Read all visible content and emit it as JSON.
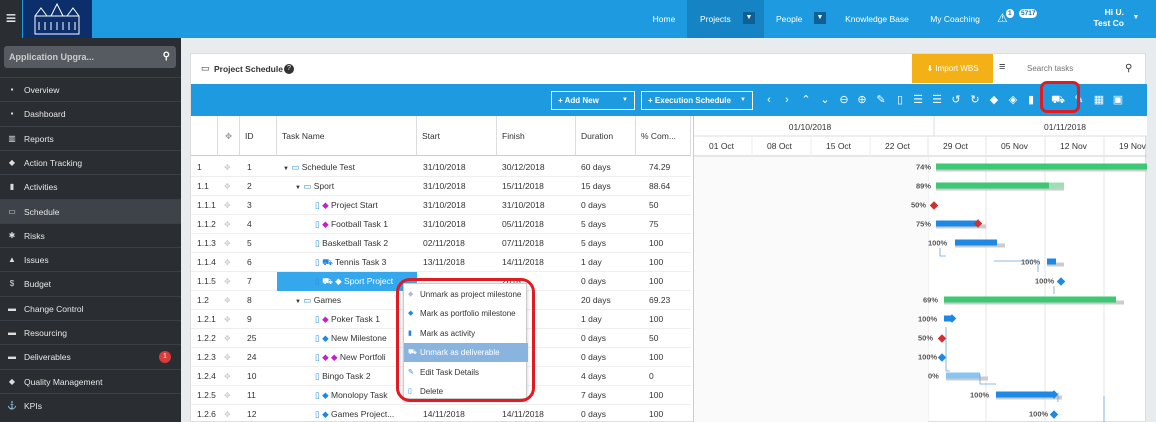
{
  "topbar": {
    "menu_icon": "hamburger-icon",
    "nav": [
      {
        "label": "Home"
      },
      {
        "label": "Projects"
      },
      {
        "label": "People"
      },
      {
        "label": "Knowledge Base"
      },
      {
        "label": "My Coaching"
      }
    ],
    "notification_count": "1",
    "message_count": "5717",
    "user_line1": "Hi U.",
    "user_line2": "Test Co"
  },
  "sidebar": {
    "app_selector": "Application Upgra...",
    "items": [
      {
        "label": "Overview",
        "icon": "monitor-icon"
      },
      {
        "label": "Dashboard",
        "icon": "dashboard-icon"
      },
      {
        "label": "Reports",
        "icon": "chart-icon"
      },
      {
        "label": "Action Tracking",
        "icon": "target-icon"
      },
      {
        "label": "Activities",
        "icon": "bookmark-icon"
      },
      {
        "label": "Schedule",
        "icon": "calendar-icon"
      },
      {
        "label": "Risks",
        "icon": "risk-icon"
      },
      {
        "label": "Issues",
        "icon": "warning-icon"
      },
      {
        "label": "Budget",
        "icon": "dollar-icon"
      },
      {
        "label": "Change Control",
        "icon": "folder-icon"
      },
      {
        "label": "Resourcing",
        "icon": "folder-icon"
      },
      {
        "label": "Deliverables",
        "icon": "folder-icon",
        "badge": "1"
      },
      {
        "label": "Quality Management",
        "icon": "tag-icon"
      },
      {
        "label": "KPIs",
        "icon": "anchor-icon"
      }
    ]
  },
  "panel": {
    "title": "Project Schedule",
    "import_label": "Import WBS",
    "search_placeholder": "Search tasks"
  },
  "toolbar": {
    "add_new": "Add New",
    "execution_schedule": "Execution Schedule"
  },
  "grid": {
    "headers": [
      "ID",
      "Task Name",
      "Start",
      "Finish",
      "Duration",
      "% Com..."
    ],
    "rows": [
      {
        "wbs": "1",
        "id": "1",
        "name": "Schedule Test",
        "start": "31/10/2018",
        "finish": "30/12/2018",
        "duration": "60 days",
        "pct": "74.29"
      },
      {
        "wbs": "1.1",
        "id": "2",
        "name": "Sport",
        "start": "31/10/2018",
        "finish": "15/11/2018",
        "duration": "15 days",
        "pct": "88.64"
      },
      {
        "wbs": "1.1.1",
        "id": "3",
        "name": "Project Start",
        "start": "31/10/2018",
        "finish": "31/10/2018",
        "duration": "0 days",
        "pct": "50"
      },
      {
        "wbs": "1.1.2",
        "id": "4",
        "name": "Football Task 1",
        "start": "31/10/2018",
        "finish": "05/11/2018",
        "duration": "5 days",
        "pct": "75"
      },
      {
        "wbs": "1.1.3",
        "id": "5",
        "name": "Basketball Task 2",
        "start": "02/11/2018",
        "finish": "07/11/2018",
        "duration": "5 days",
        "pct": "100"
      },
      {
        "wbs": "1.1.4",
        "id": "6",
        "name": "Tennis Task 3",
        "start": "13/11/2018",
        "finish": "14/11/2018",
        "duration": "1 day",
        "pct": "100"
      },
      {
        "wbs": "1.1.5",
        "id": "7",
        "name": "Sport Project",
        "start": "",
        "finish": "2018",
        "duration": "0 days",
        "pct": "100"
      },
      {
        "wbs": "1.2",
        "id": "8",
        "name": "Games",
        "start": "",
        "finish": "2018",
        "duration": "20 days",
        "pct": "69.23"
      },
      {
        "wbs": "1.2.1",
        "id": "9",
        "name": "Poker Task 1",
        "start": "",
        "finish": "2018",
        "duration": "1 day",
        "pct": "100"
      },
      {
        "wbs": "1.2.2",
        "id": "25",
        "name": "New Milestone",
        "start": "",
        "finish": "2018",
        "duration": "0 days",
        "pct": "50"
      },
      {
        "wbs": "1.2.3",
        "id": "24",
        "name": "New Portfoli",
        "start": "",
        "finish": "2018",
        "duration": "0 days",
        "pct": "100"
      },
      {
        "wbs": "1.2.4",
        "id": "10",
        "name": "Bingo Task 2",
        "start": "",
        "finish": "2018",
        "duration": "4 days",
        "pct": "0"
      },
      {
        "wbs": "1.2.5",
        "id": "11",
        "name": "Monolopy Task",
        "start": "",
        "finish": "2018",
        "duration": "7 days",
        "pct": "100"
      },
      {
        "wbs": "1.2.6",
        "id": "12",
        "name": "Games Project...",
        "start": "14/11/2018",
        "finish": "14/11/2018",
        "duration": "0 days",
        "pct": "100"
      }
    ]
  },
  "gantt": {
    "months": [
      "01/10/2018",
      "01/11/2018"
    ],
    "weeks": [
      "01 Oct",
      "08 Oct",
      "15 Oct",
      "22 Oct",
      "29 Oct",
      "05 Nov",
      "12 Nov",
      "19 Nov"
    ],
    "labels": [
      "74%",
      "89%",
      "50%",
      "75%",
      "100%",
      "100%",
      "100%",
      "69%",
      "100%",
      "50%",
      "100%",
      "0%",
      "100%",
      "100%"
    ]
  },
  "context_menu": {
    "items": [
      {
        "label": "Unmark as project milestone",
        "icon": "diamond-icon"
      },
      {
        "label": "Mark as portfolio milestone",
        "icon": "diamond-icon"
      },
      {
        "label": "Mark as activity",
        "icon": "bookmark-icon"
      },
      {
        "label": "Unmark as deliverable",
        "icon": "truck-icon"
      },
      {
        "label": "Edit Task Details",
        "icon": "pencil-icon"
      },
      {
        "label": "Delete",
        "icon": "trash-icon"
      }
    ]
  },
  "colors": {
    "brand_blue": "#1e9be0",
    "sidebar_dark": "#2a2e33",
    "import_orange": "#f3b117",
    "gantt_green": "#3cc874",
    "highlight_red": "#e01b24"
  }
}
